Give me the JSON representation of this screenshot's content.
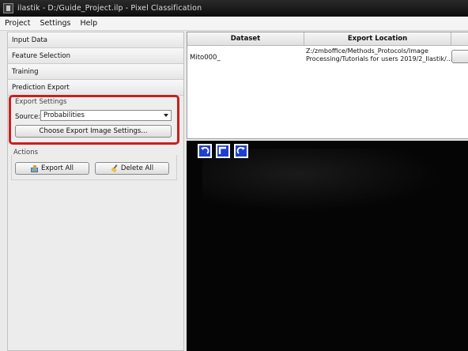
{
  "window": {
    "title": "ilastik - D:/Guide_Project.ilp - Pixel Classification"
  },
  "menu": {
    "items": [
      "Project",
      "Settings",
      "Help"
    ]
  },
  "applets": [
    "Input Data",
    "Feature Selection",
    "Training",
    "Prediction Export"
  ],
  "export_settings": {
    "title": "Export Settings",
    "source_label": "Source:",
    "source_value": "Probabilities",
    "choose_button": "Choose Export Image Settings..."
  },
  "actions": {
    "title": "Actions",
    "export_all": "Export All",
    "delete_all": "Delete All"
  },
  "table": {
    "columns": [
      "Dataset",
      "Export Location"
    ],
    "rows": [
      {
        "dataset": "Mito000_",
        "export_location_lines": [
          "Z:/zmboffice/Methods_Protocols/Image",
          "Processing/Tutorials for users 2019/2_Ilastik/..."
        ]
      }
    ]
  },
  "viewer": {
    "nav_icons": [
      "rotate-left-icon",
      "fit-view-icon",
      "rotate-right-icon"
    ]
  },
  "colors": {
    "highlight_border": "#c9201d",
    "nav_button": "#1f3fd0",
    "viewer_background": "#050505"
  }
}
